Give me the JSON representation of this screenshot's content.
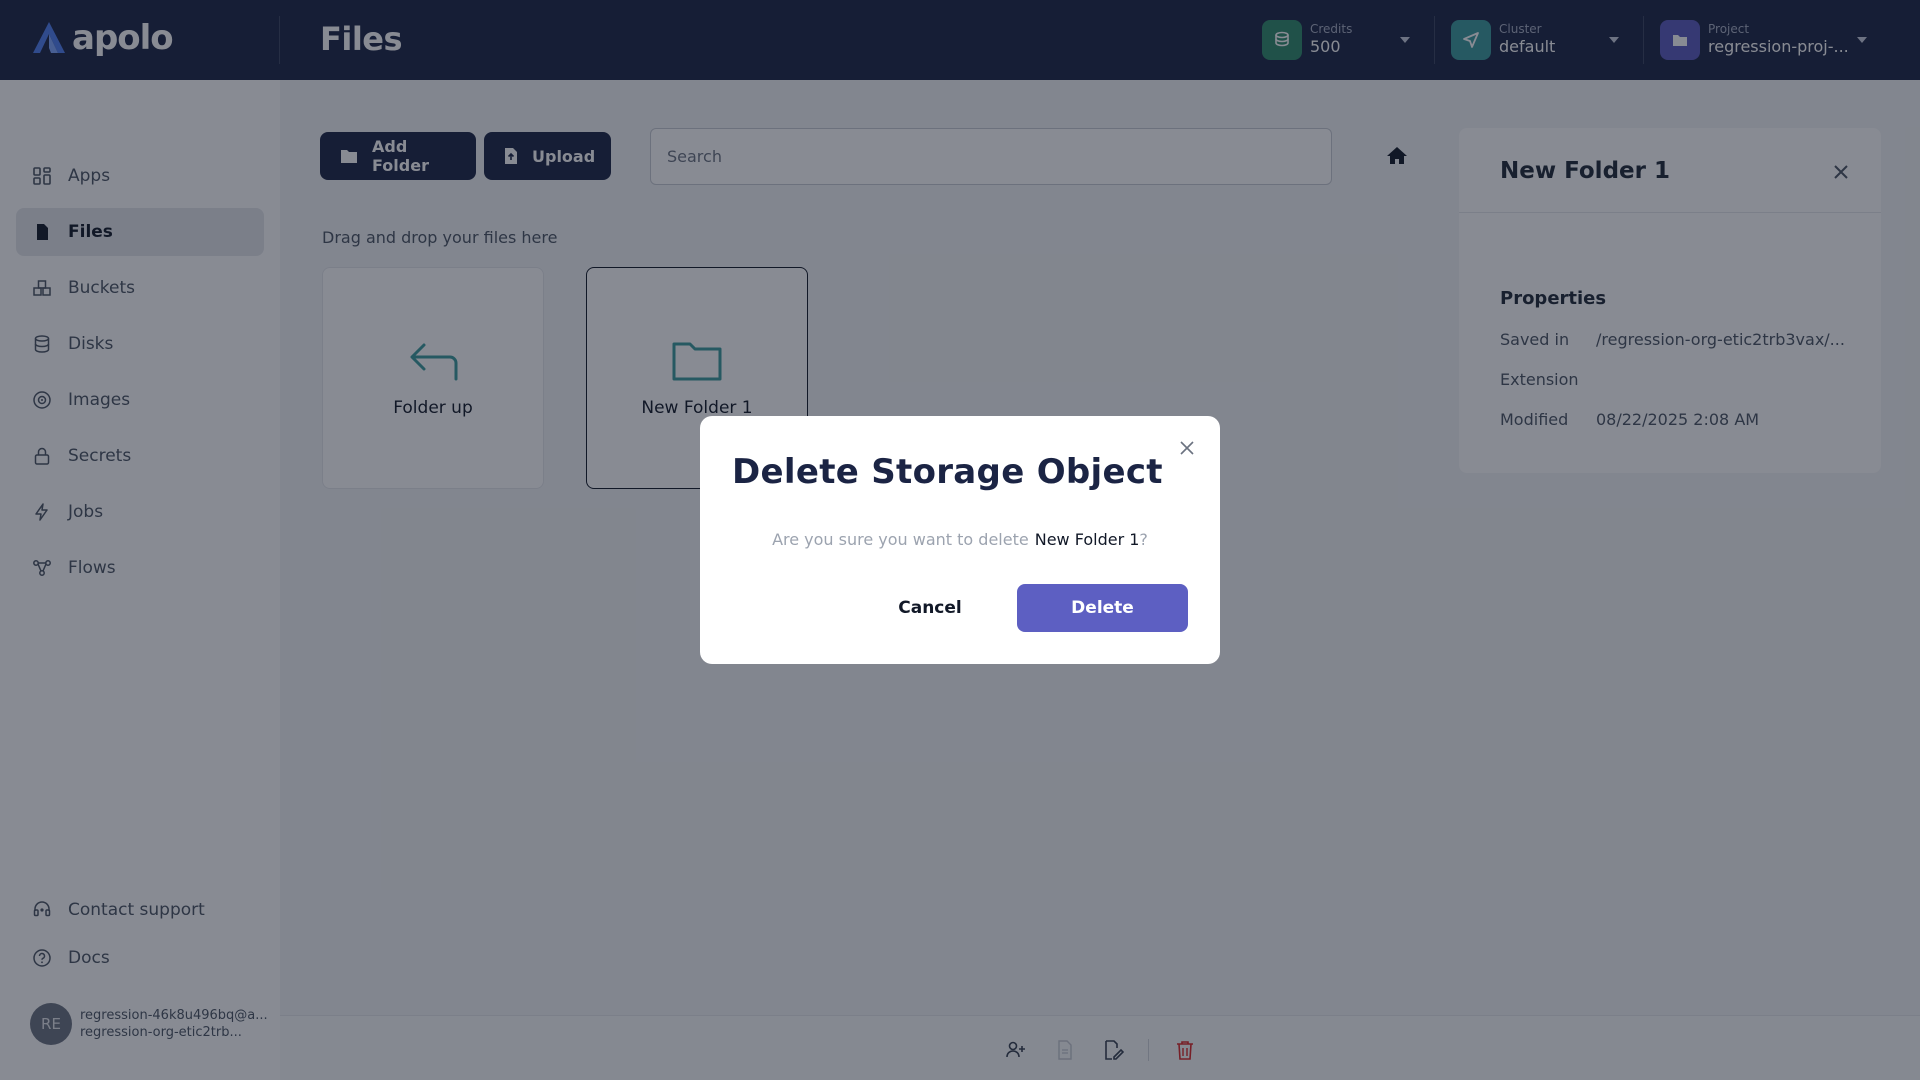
{
  "app": {
    "logo_text": "apolo",
    "page_title": "Files"
  },
  "header": {
    "credits": {
      "label": "Credits",
      "value": "500",
      "icon": "coins-icon",
      "color": "#2f8a6a"
    },
    "cluster": {
      "label": "Cluster",
      "value": "default",
      "icon": "send-icon",
      "color": "#3a9a9c"
    },
    "project": {
      "label": "Project",
      "value": "regression-proj-...",
      "icon": "folder-icon",
      "color": "#5b5bbf"
    }
  },
  "sidebar": {
    "items": [
      {
        "label": "Apps",
        "icon": "grid-icon"
      },
      {
        "label": "Files",
        "icon": "file-icon",
        "active": true
      },
      {
        "label": "Buckets",
        "icon": "buckets-icon"
      },
      {
        "label": "Disks",
        "icon": "database-icon"
      },
      {
        "label": "Images",
        "icon": "disc-icon"
      },
      {
        "label": "Secrets",
        "icon": "lock-icon"
      },
      {
        "label": "Jobs",
        "icon": "lightning-icon"
      },
      {
        "label": "Flows",
        "icon": "flow-icon"
      }
    ],
    "footer": [
      {
        "label": "Contact support",
        "icon": "headset-icon"
      },
      {
        "label": "Docs",
        "icon": "help-icon"
      }
    ],
    "user": {
      "initials": "RE",
      "email": "regression-46k8u496bq@a...",
      "org": "regression-org-etic2trb..."
    }
  },
  "toolbar": {
    "add_folder": "Add Folder",
    "upload": "Upload",
    "search_placeholder": "Search"
  },
  "files": {
    "drop_hint": "Drag and drop your files here",
    "tiles": [
      {
        "label": "Folder up",
        "icon": "arrow-up-left-icon"
      },
      {
        "label": "New Folder 1",
        "icon": "folder-icon",
        "selected": true
      }
    ]
  },
  "details": {
    "title": "New Folder 1",
    "properties_heading": "Properties",
    "saved_in_label": "Saved in",
    "saved_in_value": "/regression-org-etic2trb3vax/...",
    "extension_label": "Extension",
    "extension_value": "",
    "modified_label": "Modified",
    "modified_value": "08/22/2025 2:08 AM"
  },
  "modal": {
    "title": "Delete Storage Object",
    "question": "Are you sure you want to delete",
    "target": "New Folder 1",
    "question_end": "?",
    "cancel": "Cancel",
    "delete": "Delete",
    "accent": "#5d5fc2"
  }
}
